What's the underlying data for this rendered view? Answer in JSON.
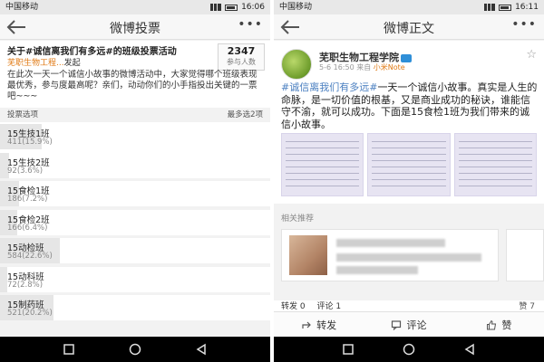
{
  "left": {
    "status": {
      "carrier": "中国移动",
      "time": "16:06"
    },
    "header": {
      "title": "微博投票"
    },
    "poll": {
      "title": "关于#诚信离我们有多远#的班级投票活动",
      "org": "芜职生物工程...",
      "posted_suffix": "发起",
      "participants_count": "2347",
      "participants_label": "参与人数",
      "description": "在此次一天一个诚信小故事的微博活动中，大家觉得哪个班级表现最优秀，参与度最高呢？亲们，动动你们的小手指投出关键的一票吧~~~",
      "options_label": "投票选项",
      "max_label": "最多选2项",
      "options": [
        {
          "name": "15生技1班",
          "stat": "411(15.9%)",
          "percent": 15.9
        },
        {
          "name": "15生技2班",
          "stat": "92(3.6%)",
          "percent": 3.6
        },
        {
          "name": "15食检1班",
          "stat": "186(7.2%)",
          "percent": 7.2
        },
        {
          "name": "15食检2班",
          "stat": "166(6.4%)",
          "percent": 6.4
        },
        {
          "name": "15动检班",
          "stat": "584(22.6%)",
          "percent": 22.6
        },
        {
          "name": "15动科班",
          "stat": "72(2.8%)",
          "percent": 2.8
        },
        {
          "name": "15制药班",
          "stat": "521(20.2%)",
          "percent": 20.2
        }
      ]
    }
  },
  "right": {
    "status": {
      "carrier": "中国移动",
      "time": "16:11"
    },
    "header": {
      "title": "微博正文"
    },
    "post": {
      "author": "芜职生物工程学院",
      "meta_date": "5-6 16:50",
      "meta_from": "来自",
      "meta_app": "小米Note",
      "hashtag": "#诚信离我们有多远#",
      "text": "一天一个诚信小故事。真实是人生的命脉，是一切价值的根基，又是商业成功的秘诀，谁能信守不渝，就可以成功。下面是15食检1班为我们带来的诚信小故事。"
    },
    "recommend_label": "相关推荐",
    "stats": {
      "repost": "转发 0",
      "comment": "评论 1",
      "liker": "赞 7"
    },
    "actions": {
      "repost": "转发",
      "comment": "评论",
      "like": "赞"
    }
  }
}
